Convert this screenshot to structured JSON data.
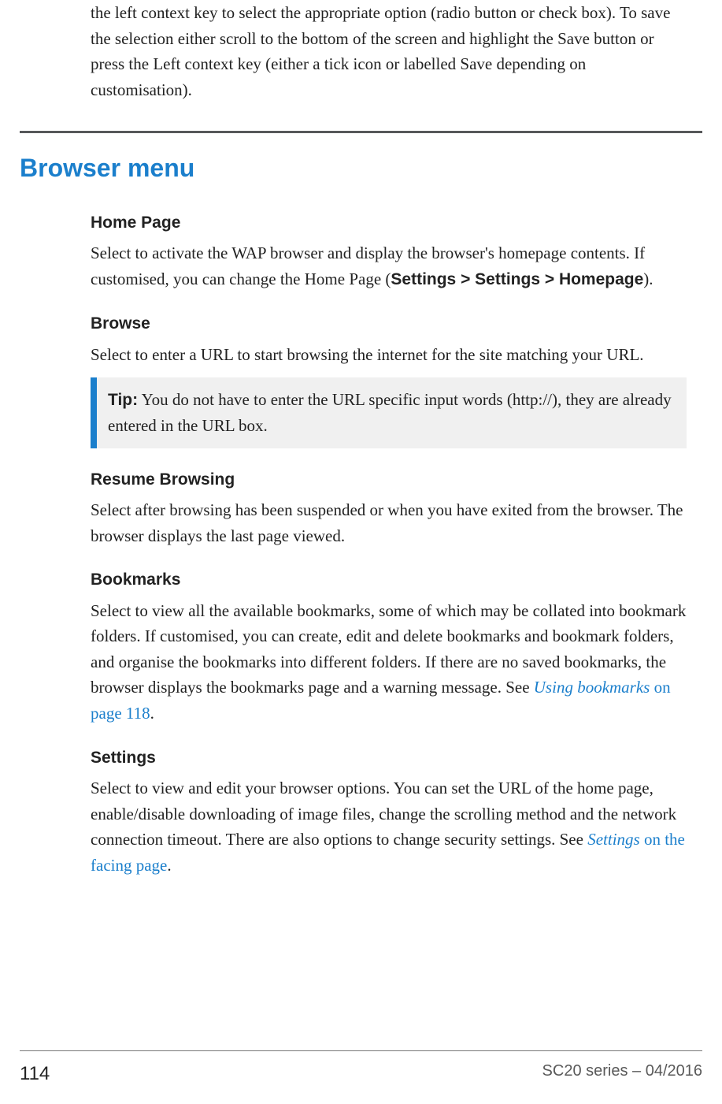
{
  "intro_paragraph": "the left context key to select the appropriate option (radio button or check box). To save the selection either scroll to the bottom of the screen and highlight the Save button or press the Left context key (either a tick icon or labelled Save depending on customisation).",
  "section_heading": "Browser menu",
  "subsections": {
    "home_page": {
      "title": "Home Page",
      "body_pre": "Select to activate the WAP browser and display the browser's homepage contents. If customised, you can change the Home Page (",
      "body_bold": "Settings > Settings > Homepage",
      "body_post": ")."
    },
    "browse": {
      "title": "Browse",
      "body": "Select to enter a URL to start browsing the internet for the site matching your URL."
    },
    "tip": {
      "label": "Tip:",
      "body": "  You do not have to enter the URL specific input words (http://), they are already entered in the URL box."
    },
    "resume": {
      "title": "Resume Browsing",
      "body": "Select after browsing has been suspended or when you have exited from the browser. The browser displays the last page viewed."
    },
    "bookmarks": {
      "title": "Bookmarks",
      "body_pre": "Select to view all the available bookmarks, some of which may be collated into bookmark folders. If customised, you can create, edit and delete bookmarks and bookmark folders, and organise the bookmarks into different folders. If there are no saved bookmarks, the browser displays the bookmarks page and a warning message. See ",
      "xref_ital": "Using bookmarks",
      "xref_rest": " on page 118",
      "body_post": "."
    },
    "settings": {
      "title": "Settings",
      "body_pre": "Select to view and edit your browser options. You can set the URL of the home page, enable/disable downloading of image files, change the scrolling method and the network connection timeout. There are also options to change security settings. See ",
      "xref_ital": "Settings",
      "xref_rest": "  on the facing page",
      "body_post": "."
    }
  },
  "footer": {
    "page_number": "114",
    "doc_id": "SC20 series – 04/2016"
  }
}
